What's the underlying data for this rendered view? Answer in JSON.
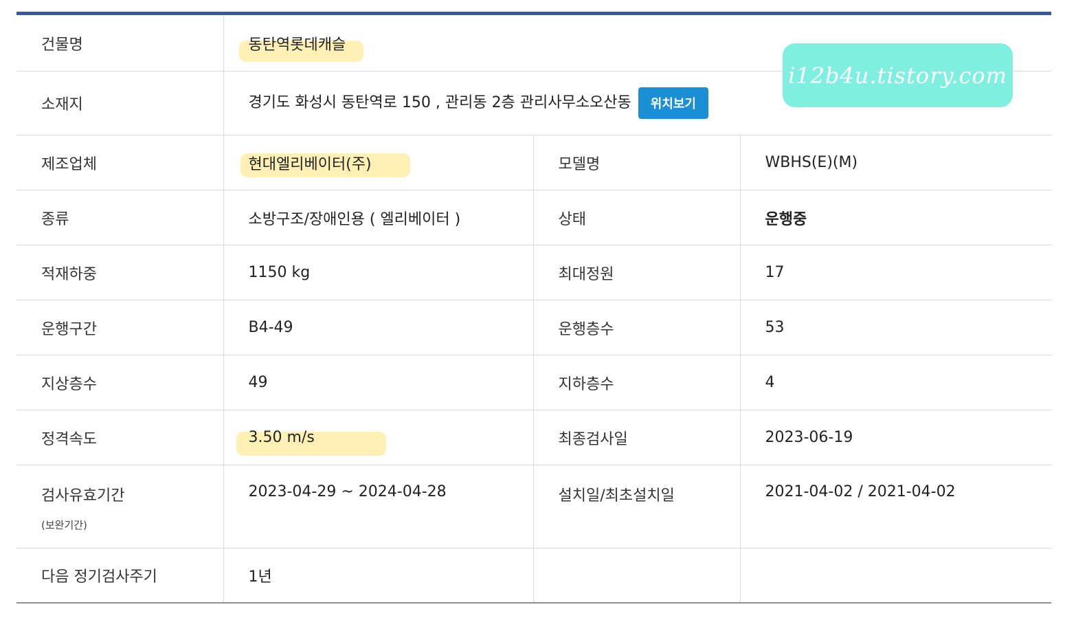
{
  "building": {
    "label": "건물명",
    "value": "동탄역롯데캐슬"
  },
  "location": {
    "label": "소재지",
    "value": "경기도 화성시 동탄역로 150 , 관리동 2층 관리사무소오산동",
    "map_button": "위치보기"
  },
  "manufacturer": {
    "label": "제조업체",
    "value": "현대엘리베이터(주)"
  },
  "model": {
    "label": "모델명",
    "value": "WBHS(E)(M)"
  },
  "type": {
    "label": "종류",
    "value": "소방구조/장애인용 ( 엘리베이터 )"
  },
  "status": {
    "label": "상태",
    "value": "운행중"
  },
  "load": {
    "label": "적재하중",
    "value": "1150 kg"
  },
  "capacity": {
    "label": "최대정원",
    "value": "17"
  },
  "section": {
    "label": "운행구간",
    "value": "B4-49"
  },
  "floors": {
    "label": "운행층수",
    "value": "53"
  },
  "above": {
    "label": "지상층수",
    "value": "49"
  },
  "below": {
    "label": "지하층수",
    "value": "4"
  },
  "speed": {
    "label": "정격속도",
    "value": "3.50 m/s"
  },
  "last_inspection": {
    "label": "최종검사일",
    "value": "2023-06-19"
  },
  "validity": {
    "label": "검사유효기간",
    "sub": "(보완기간)",
    "value": "2023-04-29 ~ 2024-04-28"
  },
  "install": {
    "label": "설치일/최초설치일",
    "value": "2021-04-02 / 2021-04-02"
  },
  "cycle": {
    "label": "다음 정기검사주기",
    "value": "1년"
  },
  "watermark": "i12b4u.tistory.com"
}
